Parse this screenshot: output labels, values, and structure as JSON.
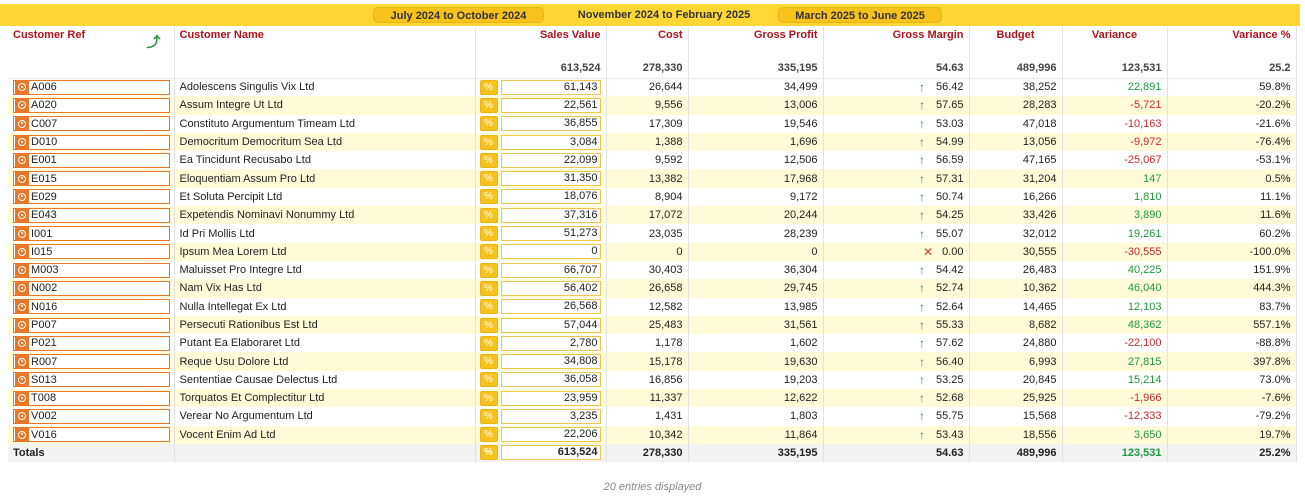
{
  "periods": [
    {
      "label": "July 2024 to October 2024",
      "active": false
    },
    {
      "label": "November 2024 to February 2025",
      "active": true
    },
    {
      "label": "March 2025 to June 2025",
      "active": false
    }
  ],
  "columns": {
    "customer_ref": "Customer Ref",
    "customer_name": "Customer Name",
    "sales_value": "Sales Value",
    "cost": "Cost",
    "gross_profit": "Gross Profit",
    "gross_margin": "Gross Margin",
    "budget": "Budget",
    "variance": "Variance",
    "variance_pct": "Variance %"
  },
  "summary": {
    "sales_value": "613,524",
    "cost": "278,330",
    "gross_profit": "335,195",
    "gross_margin": "54.63",
    "budget": "489,996",
    "variance": "123,531",
    "variance_pct": "25.2"
  },
  "rows": [
    {
      "ref": "A006",
      "name": "Adolescens Singulis Vix Ltd",
      "sales": "61,143",
      "cost": "26,644",
      "profit": "34,499",
      "trend": "up",
      "margin": "56.42",
      "budget": "38,252",
      "variance": "22,891",
      "variance_sign": "pos",
      "variance_pct": "59.8%"
    },
    {
      "ref": "A020",
      "name": "Assum Integre Ut Ltd",
      "sales": "22,561",
      "cost": "9,556",
      "profit": "13,006",
      "trend": "up",
      "margin": "57.65",
      "budget": "28,283",
      "variance": "-5,721",
      "variance_sign": "neg",
      "variance_pct": "-20.2%"
    },
    {
      "ref": "C007",
      "name": "Constituto Argumentum Timeam Ltd",
      "sales": "36,855",
      "cost": "17,309",
      "profit": "19,546",
      "trend": "up",
      "margin": "53.03",
      "budget": "47,018",
      "variance": "-10,163",
      "variance_sign": "neg",
      "variance_pct": "-21.6%"
    },
    {
      "ref": "D010",
      "name": "Democritum Democritum Sea Ltd",
      "sales": "3,084",
      "cost": "1,388",
      "profit": "1,696",
      "trend": "up",
      "margin": "54.99",
      "budget": "13,056",
      "variance": "-9,972",
      "variance_sign": "neg",
      "variance_pct": "-76.4%"
    },
    {
      "ref": "E001",
      "name": "Ea Tincidunt Recusabo Ltd",
      "sales": "22,099",
      "cost": "9,592",
      "profit": "12,506",
      "trend": "up",
      "margin": "56.59",
      "budget": "47,165",
      "variance": "-25,067",
      "variance_sign": "neg",
      "variance_pct": "-53.1%"
    },
    {
      "ref": "E015",
      "name": "Eloquentiam Assum Pro Ltd",
      "sales": "31,350",
      "cost": "13,382",
      "profit": "17,968",
      "trend": "up",
      "margin": "57.31",
      "budget": "31,204",
      "variance": "147",
      "variance_sign": "pos",
      "variance_pct": "0.5%"
    },
    {
      "ref": "E029",
      "name": "Et Soluta Percipit Ltd",
      "sales": "18,076",
      "cost": "8,904",
      "profit": "9,172",
      "trend": "up",
      "margin": "50.74",
      "budget": "16,266",
      "variance": "1,810",
      "variance_sign": "pos",
      "variance_pct": "11.1%"
    },
    {
      "ref": "E043",
      "name": "Expetendis Nominavi Nonummy Ltd",
      "sales": "37,316",
      "cost": "17,072",
      "profit": "20,244",
      "trend": "up",
      "margin": "54.25",
      "budget": "33,426",
      "variance": "3,890",
      "variance_sign": "pos",
      "variance_pct": "11.6%"
    },
    {
      "ref": "I001",
      "name": "Id Pri Mollis Ltd",
      "sales": "51,273",
      "cost": "23,035",
      "profit": "28,239",
      "trend": "up",
      "margin": "55.07",
      "budget": "32,012",
      "variance": "19,261",
      "variance_sign": "pos",
      "variance_pct": "60.2%"
    },
    {
      "ref": "I015",
      "name": "Ipsum Mea Lorem Ltd",
      "sales": "0",
      "cost": "0",
      "profit": "0",
      "trend": "none",
      "margin": "0.00",
      "budget": "30,555",
      "variance": "-30,555",
      "variance_sign": "neg",
      "variance_pct": "-100.0%"
    },
    {
      "ref": "M003",
      "name": "Maluisset Pro Integre Ltd",
      "sales": "66,707",
      "cost": "30,403",
      "profit": "36,304",
      "trend": "up",
      "margin": "54.42",
      "budget": "26,483",
      "variance": "40,225",
      "variance_sign": "pos",
      "variance_pct": "151.9%"
    },
    {
      "ref": "N002",
      "name": "Nam Vix Has Ltd",
      "sales": "56,402",
      "cost": "26,658",
      "profit": "29,745",
      "trend": "up",
      "margin": "52.74",
      "budget": "10,362",
      "variance": "46,040",
      "variance_sign": "pos",
      "variance_pct": "444.3%"
    },
    {
      "ref": "N016",
      "name": "Nulla Intellegat Ex Ltd",
      "sales": "26,568",
      "cost": "12,582",
      "profit": "13,985",
      "trend": "up",
      "margin": "52.64",
      "budget": "14,465",
      "variance": "12,103",
      "variance_sign": "pos",
      "variance_pct": "83.7%"
    },
    {
      "ref": "P007",
      "name": "Persecuti Rationibus Est Ltd",
      "sales": "57,044",
      "cost": "25,483",
      "profit": "31,561",
      "trend": "up",
      "margin": "55.33",
      "budget": "8,682",
      "variance": "48,362",
      "variance_sign": "pos",
      "variance_pct": "557.1%"
    },
    {
      "ref": "P021",
      "name": "Putant Ea Elaboraret Ltd",
      "sales": "2,780",
      "cost": "1,178",
      "profit": "1,602",
      "trend": "up",
      "margin": "57.62",
      "budget": "24,880",
      "variance": "-22,100",
      "variance_sign": "neg",
      "variance_pct": "-88.8%"
    },
    {
      "ref": "R007",
      "name": "Reque Usu Dolore Ltd",
      "sales": "34,808",
      "cost": "15,178",
      "profit": "19,630",
      "trend": "up",
      "margin": "56.40",
      "budget": "6,993",
      "variance": "27,815",
      "variance_sign": "pos",
      "variance_pct": "397.8%"
    },
    {
      "ref": "S013",
      "name": "Sententiae Causae Delectus Ltd",
      "sales": "36,058",
      "cost": "16,856",
      "profit": "19,203",
      "trend": "up",
      "margin": "53.25",
      "budget": "20,845",
      "variance": "15,214",
      "variance_sign": "pos",
      "variance_pct": "73.0%"
    },
    {
      "ref": "T008",
      "name": "Torquatos Et Complectitur Ltd",
      "sales": "23,959",
      "cost": "11,337",
      "profit": "12,622",
      "trend": "up",
      "margin": "52.68",
      "budget": "25,925",
      "variance": "-1,966",
      "variance_sign": "neg",
      "variance_pct": "-7.6%"
    },
    {
      "ref": "V002",
      "name": "Verear No Argumentum Ltd",
      "sales": "3,235",
      "cost": "1,431",
      "profit": "1,803",
      "trend": "up",
      "margin": "55.75",
      "budget": "15,568",
      "variance": "-12,333",
      "variance_sign": "neg",
      "variance_pct": "-79.2%"
    },
    {
      "ref": "V016",
      "name": "Vocent Enim Ad Ltd",
      "sales": "22,206",
      "cost": "10,342",
      "profit": "11,864",
      "trend": "up",
      "margin": "53.43",
      "budget": "18,556",
      "variance": "3,650",
      "variance_sign": "pos",
      "variance_pct": "19.7%"
    }
  ],
  "totals": {
    "label": "Totals",
    "sales_value": "613,524",
    "cost": "278,330",
    "gross_profit": "335,195",
    "gross_margin": "54.63",
    "budget": "489,996",
    "variance": "123,531",
    "variance_pct": "25.2%"
  },
  "footer": "20 entries displayed",
  "colors": {
    "accent_yellow": "#ffd735",
    "header_red": "#b3121b",
    "ref_orange": "#e8772a",
    "positive_green": "#1e9a3c",
    "negative_red": "#d0262d",
    "row_alt": "#fffbd6"
  },
  "icons": {
    "sort": "sort-ascending-icon",
    "ref": "target-icon",
    "sales": "link-icon",
    "trend_up": "arrow-up-icon",
    "trend_none": "cross-icon"
  }
}
